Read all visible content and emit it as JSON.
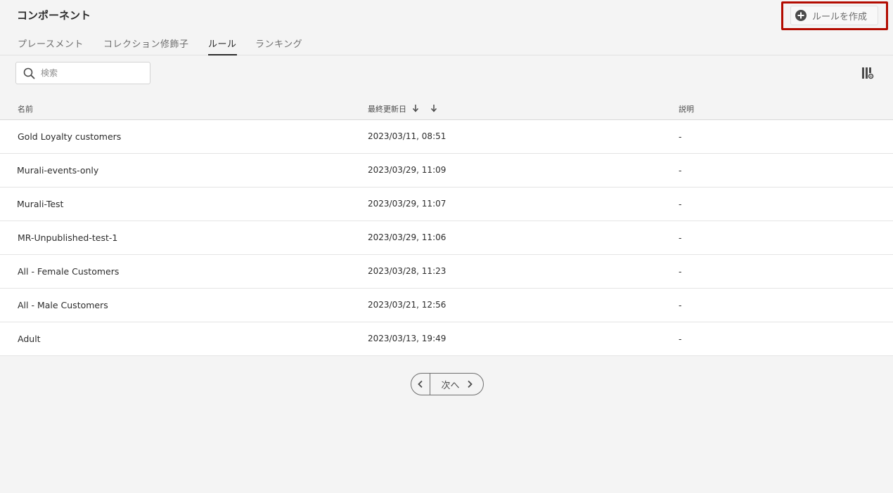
{
  "header": {
    "title": "コンポーネント",
    "create_button_label": "ルールを作成"
  },
  "tabs": [
    {
      "label": "プレースメント",
      "active": false
    },
    {
      "label": "コレクション修飾子",
      "active": false
    },
    {
      "label": "ルール",
      "active": true
    },
    {
      "label": "ランキング",
      "active": false
    }
  ],
  "search": {
    "placeholder": "検索",
    "value": ""
  },
  "table": {
    "columns": {
      "name": "名前",
      "modified": "最終更新日",
      "description": "説明"
    },
    "rows": [
      {
        "name": "Gold Loyalty customers",
        "modified": "2023/03/11, 08:51",
        "description": "-"
      },
      {
        "name": "Murali-events-only",
        "modified": "2023/03/29, 11:09",
        "description": "-"
      },
      {
        "name": "Murali-Test",
        "modified": "2023/03/29, 11:07",
        "description": "-"
      },
      {
        "name": "MR-Unpublished-test-1",
        "modified": "2023/03/29, 11:06",
        "description": "-"
      },
      {
        "name": "All - Female Customers",
        "modified": "2023/03/28, 11:23",
        "description": "-"
      },
      {
        "name": "All - Male Customers",
        "modified": "2023/03/21, 12:56",
        "description": "-"
      },
      {
        "name": "Adult",
        "modified": "2023/03/13, 19:49",
        "description": "-"
      }
    ]
  },
  "pager": {
    "next_label": "次へ"
  },
  "colors": {
    "highlight": "#b30b00",
    "background": "#f4f4f4"
  }
}
